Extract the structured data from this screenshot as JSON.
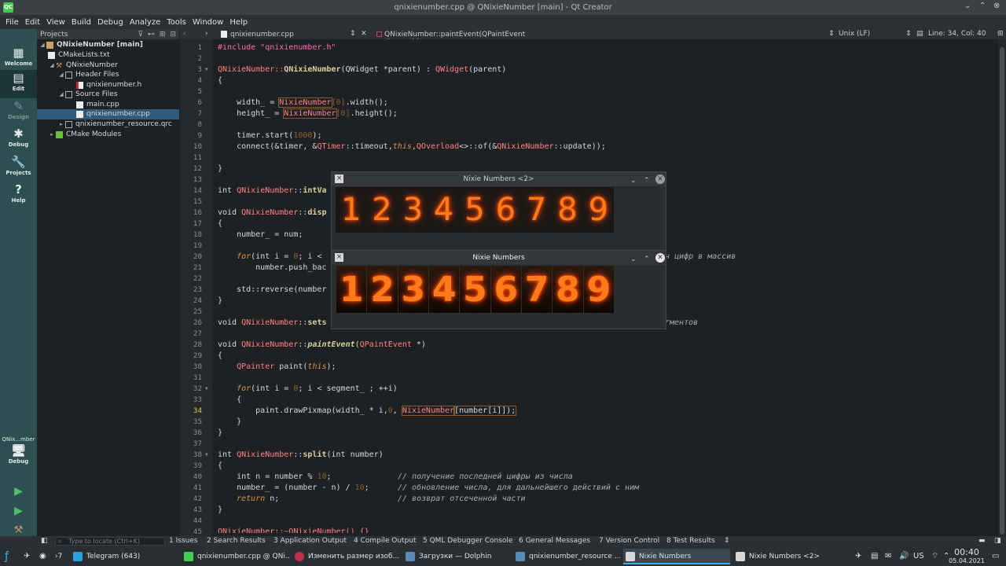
{
  "titlebar": {
    "title": "qnixienumber.cpp @ QNixieNumber [main] - Qt Creator"
  },
  "menu": [
    "File",
    "Edit",
    "View",
    "Build",
    "Debug",
    "Analyze",
    "Tools",
    "Window",
    "Help"
  ],
  "modes": [
    "Welcome",
    "Edit",
    "Design",
    "Debug",
    "Projects",
    "Help"
  ],
  "kit": {
    "name": "QNix...mber",
    "config": "Debug"
  },
  "projects": {
    "header": "Projects",
    "tree": [
      "QNixieNumber [main]",
      "CMakeLists.txt",
      "QNixieNumber",
      "Header Files",
      "qnixienumber.h",
      "Source Files",
      "main.cpp",
      "qnixienumber.cpp",
      "qnixienumber_resource.qrc",
      "CMake Modules"
    ]
  },
  "editor": {
    "file": "qnixienumber.cpp",
    "symbol": "QNixieNumber::paintEvent(QPaintEvent *) -> void",
    "eol": "Unix (LF)",
    "position": "Line: 34, Col: 40"
  },
  "code": {
    "l1": "#include \"qnixienumber.h\"",
    "l3a": "QNixieNumber::",
    "l3b": "QNixieNumber",
    "l3c": "(QWidget *parent) : ",
    "l3d": "QWidget",
    "l3e": "(parent)",
    "l4": "{",
    "l6a": "    width_ = ",
    "l6b": "NixieNumber",
    "l6c": "[0]",
    "l6d": ".width();",
    "l7a": "    height_ = ",
    "l7b": "NixieNumber",
    "l7c": "[0]",
    "l7d": ".height();",
    "l9a": "    timer.start(",
    "l9b": "1000",
    "l9c": ");",
    "l10a": "    connect(&timer, &",
    "l10b": "QTimer",
    "l10c": "::timeout,",
    "l10d": "this",
    "l10e": ",",
    "l10f": "QOverload",
    "l10g": "<>::of(&",
    "l10h": "QNixieNumber",
    "l10i": "::update));",
    "l12": "}",
    "l14a": "int ",
    "l14b": "QNixieNumber",
    "l14c": "::",
    "l14d": "intVa",
    "l16a": "void ",
    "l16b": "QNixieNumber",
    "l16c": "::",
    "l16d": "disp",
    "l17": "{",
    "l18": "    number_ = num;",
    "l20a": "    ",
    "l20b": "for",
    "l20c": "(int i = ",
    "l20d": "0",
    "l20e": "; i <",
    "l20tail": "ч цифр в массив",
    "l21": "        number.push_bac",
    "l23": "    std::reverse(number",
    "l24": "}",
    "l26a": "void ",
    "l26b": "QNixieNumber",
    "l26c": "::",
    "l26d": "sets",
    "l26tail": "гментов",
    "l28a": "void ",
    "l28b": "QNixieNumber",
    "l28c": "::",
    "l28d": "paintEvent",
    "l28e": "(",
    "l28f": "QPaintEvent",
    " l28g": " *)",
    "l28g": " *)",
    "l29": "{",
    "l30a": "    ",
    "l30b": "QPainter",
    " l30c": " paint(",
    "l30c": " paint(",
    "l30d": "this",
    "l30e": ");",
    "l32a": "    ",
    "l32b": "for",
    "l32c": "(int i = ",
    "l32d": "0",
    "l32e": "; i < segment_ ; ++i)",
    "l33": "    {",
    "l34a": "        paint.drawPixmap(width_ * i,",
    "l34b": "0",
    "l34c": ", ",
    "l34d": "NixieNumber",
    "l34e": "[number[i]]);",
    "l35": "    }",
    "l36": "}",
    "l38a": "int ",
    "l38b": "QNixieNumber",
    "l38c": "::",
    "l38d": "split",
    "l38e": "(int number)",
    "l39": "{",
    "l40a": "    int n = number % ",
    "l40b": "10",
    "l40c": ";",
    "l40d": "// получение последней цифры из числа",
    "l41a": "    number_ = (number - n) / ",
    "l41b": "10",
    "l41c": ";",
    "l41d": "// обновление числа, для дальнейшего действий с ним",
    "l42a": "    ",
    "l42b": "return",
    " l42c": " n;",
    "l42c": " n;",
    "l42d": "// возврат отсеченной части",
    "l43": "}",
    "l45": "QNixieNumber::~QNixieNumber() {}"
  },
  "windows": {
    "w1": {
      "title": "Nixie Numbers <2>",
      "digits": [
        "1",
        "2",
        "3",
        "4",
        "5",
        "6",
        "7",
        "8",
        "9"
      ]
    },
    "w2": {
      "title": "Nixie Numbers",
      "digits": [
        "1",
        "2",
        "3",
        "4",
        "5",
        "6",
        "7",
        "8",
        "9"
      ]
    }
  },
  "status": {
    "locate": "Type to locate (Ctrl+K)",
    "panes": [
      "1 Issues",
      "2 Search Results",
      "3 Application Output",
      "4 Compile Output",
      "5 QML Debugger Console",
      "6 General Messages",
      "7 Version Control",
      "8 Test Results"
    ]
  },
  "taskbar": {
    "tasks": [
      "Telegram (643)",
      "qnixienumber.cpp @ QNi...",
      "Изменить размер изоб...",
      "Загрузки — Dolphin",
      "qnixienumber_resource ...",
      "Nixie Numbers",
      "Nixie Numbers <2>"
    ],
    "layout": "US",
    "time": "00:40",
    "date": "05.04.2021"
  },
  "colors": {
    "accent": "#3daee9",
    "sidebar": "#2d4f52",
    "nixie": "#ff7a1a"
  }
}
